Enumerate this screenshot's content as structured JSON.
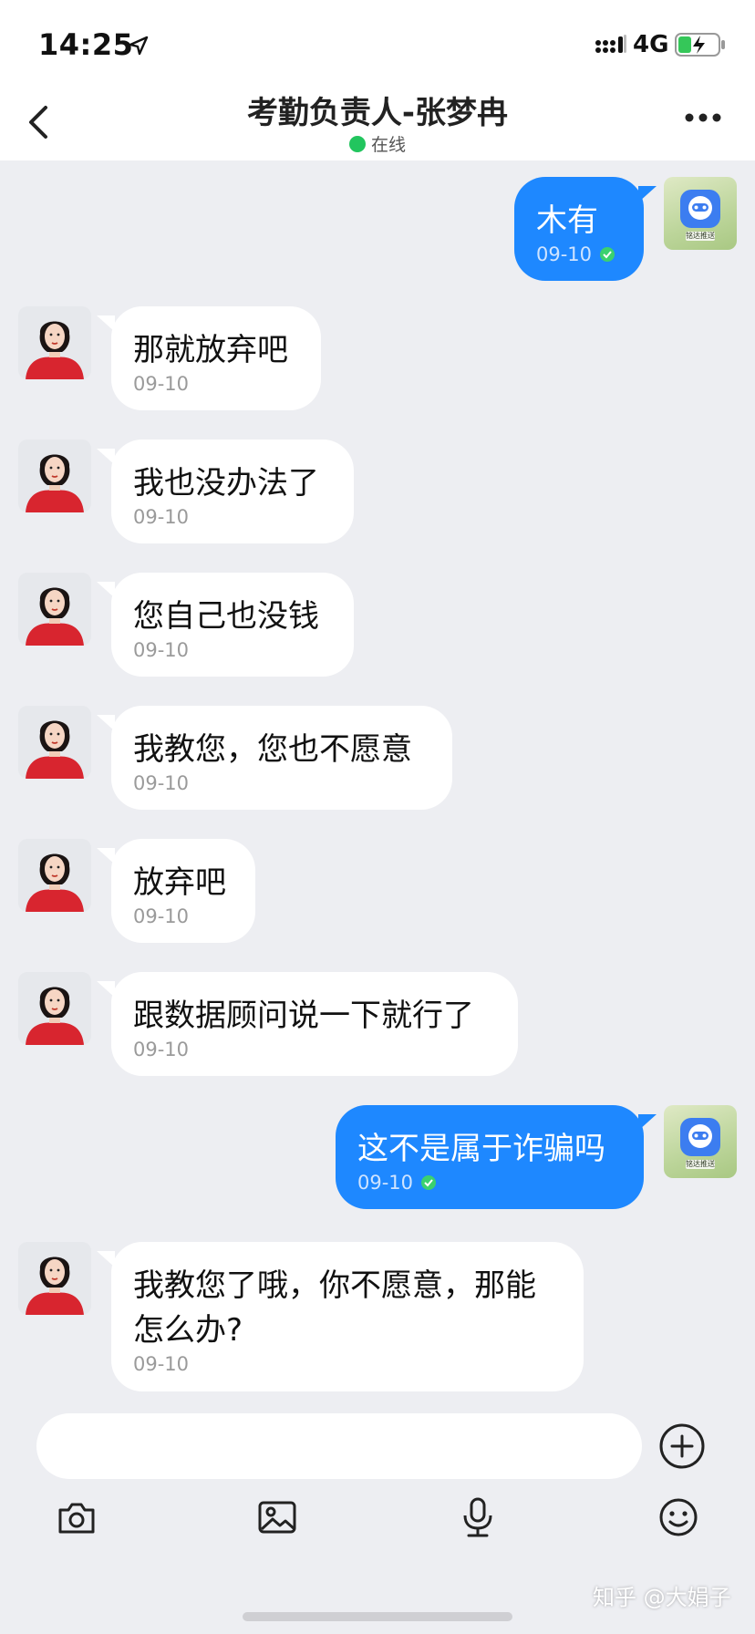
{
  "status_bar": {
    "time": "14:25",
    "network": "4G",
    "icons": [
      "location-arrow-icon",
      "signal-icon",
      "battery-charging-icon"
    ]
  },
  "header": {
    "title": "考勤负责人-张梦冉",
    "status": "在线"
  },
  "messages": [
    {
      "side": "out",
      "text": "木有",
      "time": "09-10",
      "sender_avatar": "app-logo-avatar",
      "avatar_caption": "铭达推送"
    },
    {
      "side": "in",
      "text": "那就放弃吧",
      "time": "09-10"
    },
    {
      "side": "in",
      "text": "我也没办法了",
      "time": "09-10"
    },
    {
      "side": "in",
      "text": "您自己也没钱",
      "time": "09-10"
    },
    {
      "side": "in",
      "text": "我教您，您也不愿意",
      "time": "09-10"
    },
    {
      "side": "in",
      "text": "放弃吧",
      "time": "09-10"
    },
    {
      "side": "in",
      "text": "跟数据顾问说一下就行了",
      "time": "09-10"
    },
    {
      "side": "out",
      "text": "这不是属于诈骗吗",
      "time": "09-10",
      "sender_avatar": "app-logo-avatar",
      "avatar_caption": "铭达推送"
    },
    {
      "side": "in",
      "text": "我教您了哦，你不愿意，那能\n怎么办?",
      "time": "09-10"
    }
  ],
  "composer": {
    "placeholder": "",
    "tools": [
      "camera-icon",
      "image-icon",
      "microphone-icon",
      "emoji-icon"
    ]
  },
  "watermark": "知乎 @大娟子",
  "colors": {
    "outgoing_bubble": "#1e88ff",
    "incoming_bubble": "#ffffff",
    "background": "#edeef2",
    "online": "#22c55e"
  }
}
